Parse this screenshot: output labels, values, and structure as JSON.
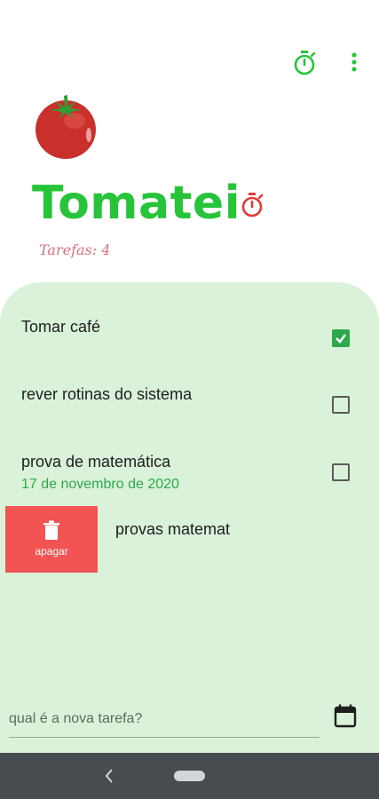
{
  "app": {
    "title": "Tomatei",
    "task_count_label": "Tarefas: 4"
  },
  "icons": {
    "logo": "tomato-icon",
    "timer": "stopwatch-icon",
    "menu": "more-vert-icon",
    "calendar": "calendar-icon",
    "delete": "trash-icon"
  },
  "colors": {
    "brand_green": "#27c43a",
    "panel_bg": "#d9f2d9",
    "accent_red": "#e53935",
    "delete_bg": "#f25454",
    "date_green": "#2ea84a",
    "count_pink": "#d9707f"
  },
  "tasks": [
    {
      "title": "Tomar café",
      "date": "",
      "checked": true
    },
    {
      "title": "rever rotinas do sistema",
      "date": "",
      "checked": false
    },
    {
      "title": "prova de matemática",
      "date": "17 de novembro de 2020",
      "checked": false
    }
  ],
  "swiped_task": {
    "title": "provas matemat",
    "action_label": "apagar"
  },
  "new_task": {
    "placeholder": "qual é a nova tarefa?",
    "value": ""
  }
}
